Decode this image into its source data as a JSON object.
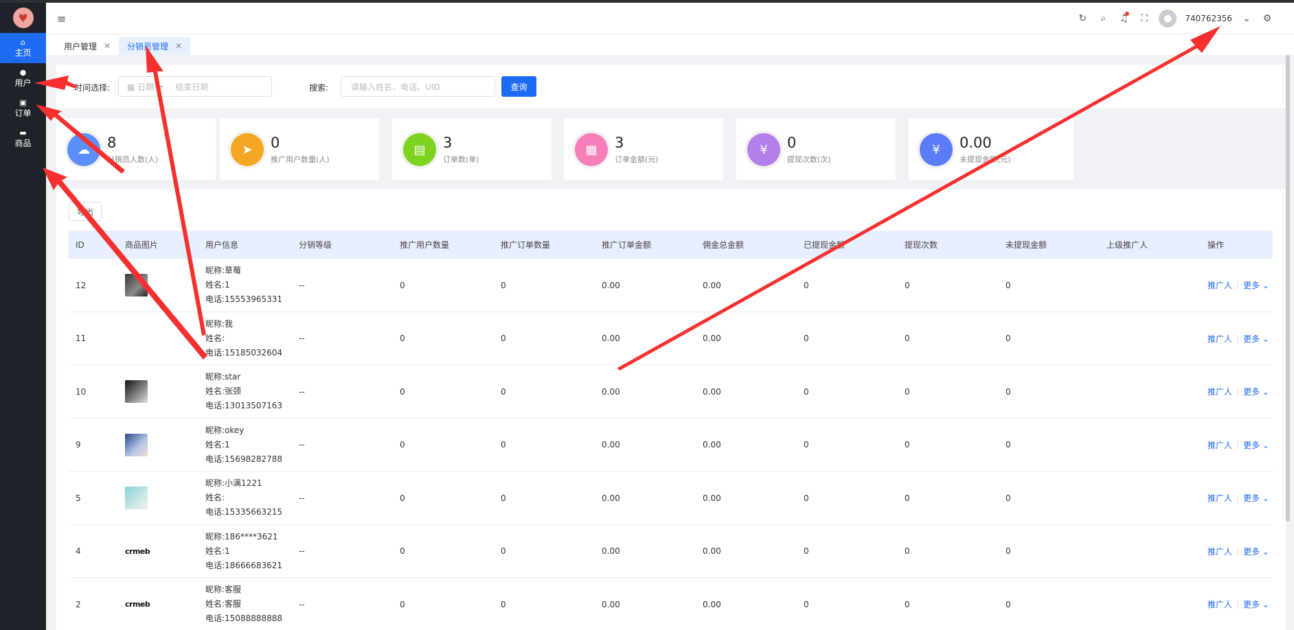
{
  "sidebar": {
    "logo_icon": "peach-logo-icon",
    "items": [
      {
        "icon": "⌂",
        "label": "主页",
        "active": true
      },
      {
        "icon": "●",
        "label": "用户",
        "active": false
      },
      {
        "icon": "▣",
        "label": "订单",
        "active": false
      },
      {
        "icon": "▬",
        "label": "商品",
        "active": false
      }
    ]
  },
  "header": {
    "menu_icon": "≡",
    "icons": [
      "refresh-icon",
      "search-icon",
      "bell-icon",
      "fullscreen-icon"
    ],
    "username": "740762356",
    "settings_icon": "gear-icon"
  },
  "tabs": [
    {
      "label": "用户管理",
      "active": false
    },
    {
      "label": "分销员管理",
      "active": true
    }
  ],
  "filter": {
    "date_label": "时间选择:",
    "date_start_placeholder": "日期",
    "date_sep": "-",
    "date_end_placeholder": "结束日期",
    "search_label": "搜索:",
    "search_placeholder": "请输入姓名、电话、UID",
    "query_button": "查询"
  },
  "stats": [
    {
      "value": "8",
      "label": "分销员人数(人)",
      "color": "#5b8ff9",
      "icon": "☁"
    },
    {
      "value": "0",
      "label": "推广用户数量(人)",
      "color": "#f5a623",
      "icon": "➤"
    },
    {
      "value": "3",
      "label": "订单数(单)",
      "color": "#7ed321",
      "icon": "▤"
    },
    {
      "value": "3",
      "label": "订单金额(元)",
      "color": "#f77eb9",
      "icon": "▦"
    },
    {
      "value": "0",
      "label": "提现次数(次)",
      "color": "#b37feb",
      "icon": "¥"
    },
    {
      "value": "0.00",
      "label": "未提现金额(元)",
      "color": "#5b7cf9",
      "icon": "¥"
    }
  ],
  "table": {
    "small_button": "导出",
    "columns": [
      "ID",
      "商品图片",
      "用户信息",
      "分销等级",
      "推广用户数量",
      "推广订单数量",
      "推广订单金额",
      "佣金总金额",
      "已提现金额",
      "提现次数",
      "未提现金额",
      "上级推广人",
      "操作"
    ],
    "rows": [
      {
        "id": "12",
        "img": "photo-dark",
        "nick": "昵称:草莓",
        "name": "姓名:1",
        "phone": "电话:15553965331",
        "level": "--",
        "users": "0",
        "orders": "0",
        "order_amt": "0.00",
        "comm": "0.00",
        "withdrawn": "0",
        "times": "0",
        "unwithdrawn": "0",
        "parent": "",
        "op1": "推广人",
        "op2": "更多"
      },
      {
        "id": "11",
        "img": "none",
        "nick": "昵称:我",
        "name": "姓名:",
        "phone": "电话:15185032604",
        "level": "--",
        "users": "0",
        "orders": "0",
        "order_amt": "0.00",
        "comm": "0.00",
        "withdrawn": "0",
        "times": "0",
        "unwithdrawn": "0",
        "parent": "",
        "op1": "推广人",
        "op2": "更多"
      },
      {
        "id": "10",
        "img": "photo-portrait",
        "nick": "昵称:star",
        "name": "姓名:张颈",
        "phone": "电话:13013507163",
        "level": "--",
        "users": "0",
        "orders": "0",
        "order_amt": "0.00",
        "comm": "0.00",
        "withdrawn": "0",
        "times": "0",
        "unwithdrawn": "0",
        "parent": "",
        "op1": "推广人",
        "op2": "更多"
      },
      {
        "id": "9",
        "img": "photo-blue",
        "nick": "昵称:okey",
        "name": "姓名:1",
        "phone": "电话:15698282788",
        "level": "--",
        "users": "0",
        "orders": "0",
        "order_amt": "0.00",
        "comm": "0.00",
        "withdrawn": "0",
        "times": "0",
        "unwithdrawn": "0",
        "parent": "",
        "op1": "推广人",
        "op2": "更多"
      },
      {
        "id": "5",
        "img": "photo-teal",
        "nick": "昵称:小满1221",
        "name": "姓名:",
        "phone": "电话:15335663215",
        "level": "--",
        "users": "0",
        "orders": "0",
        "order_amt": "0.00",
        "comm": "0.00",
        "withdrawn": "0",
        "times": "0",
        "unwithdrawn": "0",
        "parent": "",
        "op1": "推广人",
        "op2": "更多"
      },
      {
        "id": "4",
        "img": "crmeb",
        "nick": "昵称:186****3621",
        "name": "姓名:1",
        "phone": "电话:18666683621",
        "level": "--",
        "users": "0",
        "orders": "0",
        "order_amt": "0.00",
        "comm": "0.00",
        "withdrawn": "0",
        "times": "0",
        "unwithdrawn": "0",
        "parent": "",
        "op1": "推广人",
        "op2": "更多"
      },
      {
        "id": "2",
        "img": "crmeb",
        "nick": "昵称:客服",
        "name": "姓名:客服",
        "phone": "电话:15088888888",
        "level": "--",
        "users": "0",
        "orders": "0",
        "order_amt": "0.00",
        "comm": "0.00",
        "withdrawn": "0",
        "times": "0",
        "unwithdrawn": "0",
        "parent": "",
        "op1": "推广人",
        "op2": "更多"
      }
    ],
    "crmeb_text": "crmeb"
  },
  "colors": {
    "accent": "#1d6bf2",
    "sidebar": "#1f2329",
    "arrow": "#f5302e"
  }
}
